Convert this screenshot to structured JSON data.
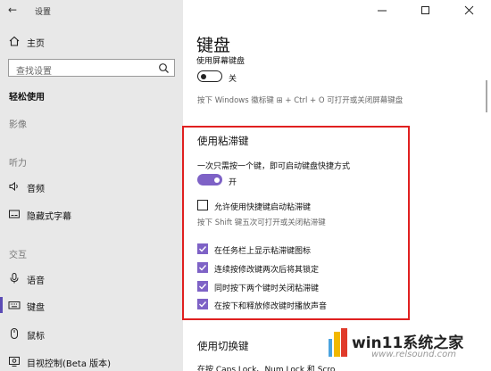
{
  "app": {
    "title": "设置",
    "back_icon": "back-arrow-icon"
  },
  "window": {
    "minimize": "minimize-icon",
    "maximize": "maximize-icon",
    "close": "close-icon"
  },
  "sidebar": {
    "home": {
      "label": "主页",
      "icon": "home-icon"
    },
    "search_placeholder": "查找设置",
    "section_title": "轻松使用",
    "groups": {
      "vision": "影像",
      "hearing": "听力",
      "interaction": "交互"
    },
    "items": [
      {
        "label": "音频",
        "icon": "speaker-icon"
      },
      {
        "label": "隐藏式字幕",
        "icon": "captions-icon"
      },
      {
        "label": "语音",
        "icon": "microphone-icon"
      },
      {
        "label": "键盘",
        "icon": "keyboard-icon",
        "active": true
      },
      {
        "label": "鼠标",
        "icon": "mouse-icon"
      },
      {
        "label": "目视控制(Beta 版本)",
        "icon": "eye-control-icon"
      }
    ]
  },
  "main": {
    "title": "键盘",
    "onscreen": {
      "label": "使用屏幕键盘",
      "state_text": "关",
      "state": false,
      "hint": "按下 Windows 徽标键 ⊞ + Ctrl + O 可打开或关闭屏幕键盘"
    },
    "sticky": {
      "title": "使用粘滞键",
      "shortcut_desc": "一次只需按一个键，即可启动键盘快捷方式",
      "state_text": "开",
      "state": true,
      "allow_shortcut": {
        "label": "允许使用快捷键启动粘滞键",
        "checked": false
      },
      "shift_hint": "按下 Shift 键五次可打开或关闭粘滞键",
      "options": [
        {
          "label": "在任务栏上显示粘滞键图标",
          "checked": true
        },
        {
          "label": "连续按修改键两次后将其锁定",
          "checked": true
        },
        {
          "label": "同时按下两个键时关闭粘滞键",
          "checked": true
        },
        {
          "label": "在按下和释放修改键时播放声音",
          "checked": true
        }
      ]
    },
    "toggle_keys": {
      "title": "使用切换键",
      "desc_partial": "在按 Caps Lock、Num Lock 和 Scro"
    }
  },
  "watermark": {
    "text": "win11系统之家",
    "url": "www.relsound.com"
  },
  "colors": {
    "accent": "#7e62c6",
    "highlight_box": "#e02020",
    "sidebar_bg": "#e8e8e8"
  }
}
